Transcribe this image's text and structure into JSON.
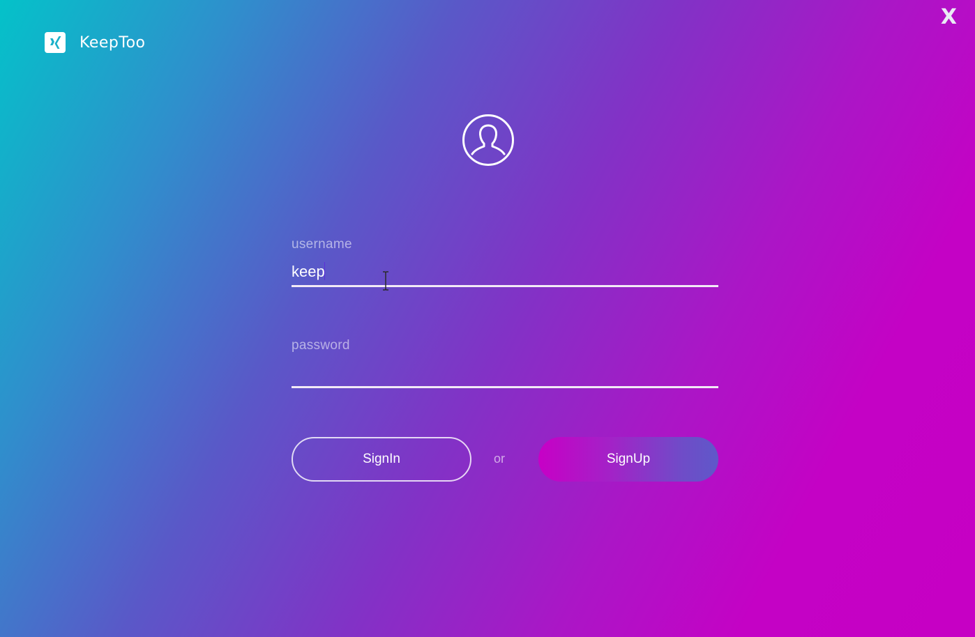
{
  "app": {
    "name": "KeepToo",
    "logo_icon": "xing-logo-icon",
    "close_label": "X"
  },
  "avatar": {
    "icon": "user-avatar-icon"
  },
  "form": {
    "username": {
      "label": "username",
      "value": "keep"
    },
    "password": {
      "label": "password",
      "value": ""
    },
    "signin_label": "SignIn",
    "or_label": "or",
    "signup_label": "SignUp"
  },
  "colors": {
    "gradient_start": "#04c2c9",
    "gradient_mid": "#8232c6",
    "gradient_end": "#c600c4"
  }
}
